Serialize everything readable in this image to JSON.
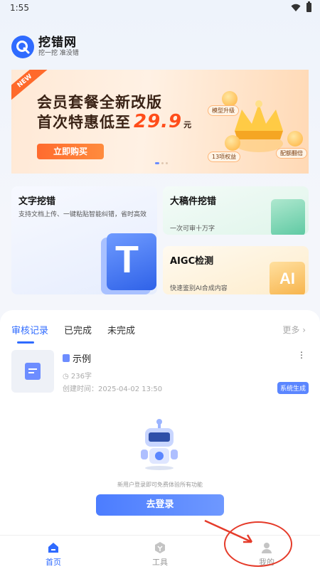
{
  "status_bar": {
    "time": "1:55"
  },
  "brand": {
    "name": "挖错网",
    "slogan": "挖一挖 准没错"
  },
  "banner": {
    "ribbon": "NEW",
    "line1": "会员套餐全新改版",
    "line2_prefix": "首次特惠低至",
    "price": "29.9",
    "unit": "元",
    "cta": "立即购买",
    "pills": [
      "模型升级",
      "13项权益",
      "配额翻倍"
    ]
  },
  "features": {
    "text_check": {
      "title": "文字挖错",
      "desc": "支持文档上传、一键粘贴智能纠错，省时高效",
      "icon": "T"
    },
    "big_doc": {
      "title": "大稿件挖错",
      "desc": "一次可审十万字"
    },
    "aigc": {
      "title": "AIGC检测",
      "desc": "快速鉴别AI合成内容",
      "icon": "AI"
    }
  },
  "records": {
    "tabs": [
      "审核记录",
      "已完成",
      "未完成"
    ],
    "more": "更多 ›",
    "item": {
      "title": "示例",
      "words": "236字",
      "created": "创建时间：2025-04-02 13:50",
      "badge": "系统生成",
      "menu": "⋮"
    },
    "hint": "新用户登录即可免费体验所有功能",
    "login": "去登录"
  },
  "nav": [
    {
      "label": "首页",
      "icon": "home-icon",
      "active": true
    },
    {
      "label": "工具",
      "icon": "tools-icon",
      "active": false
    },
    {
      "label": "我的",
      "icon": "profile-icon",
      "active": false
    }
  ],
  "colors": {
    "accent": "#2f6bff",
    "banner_price": "#ff4d1a",
    "annotation": "#e53b2a"
  }
}
